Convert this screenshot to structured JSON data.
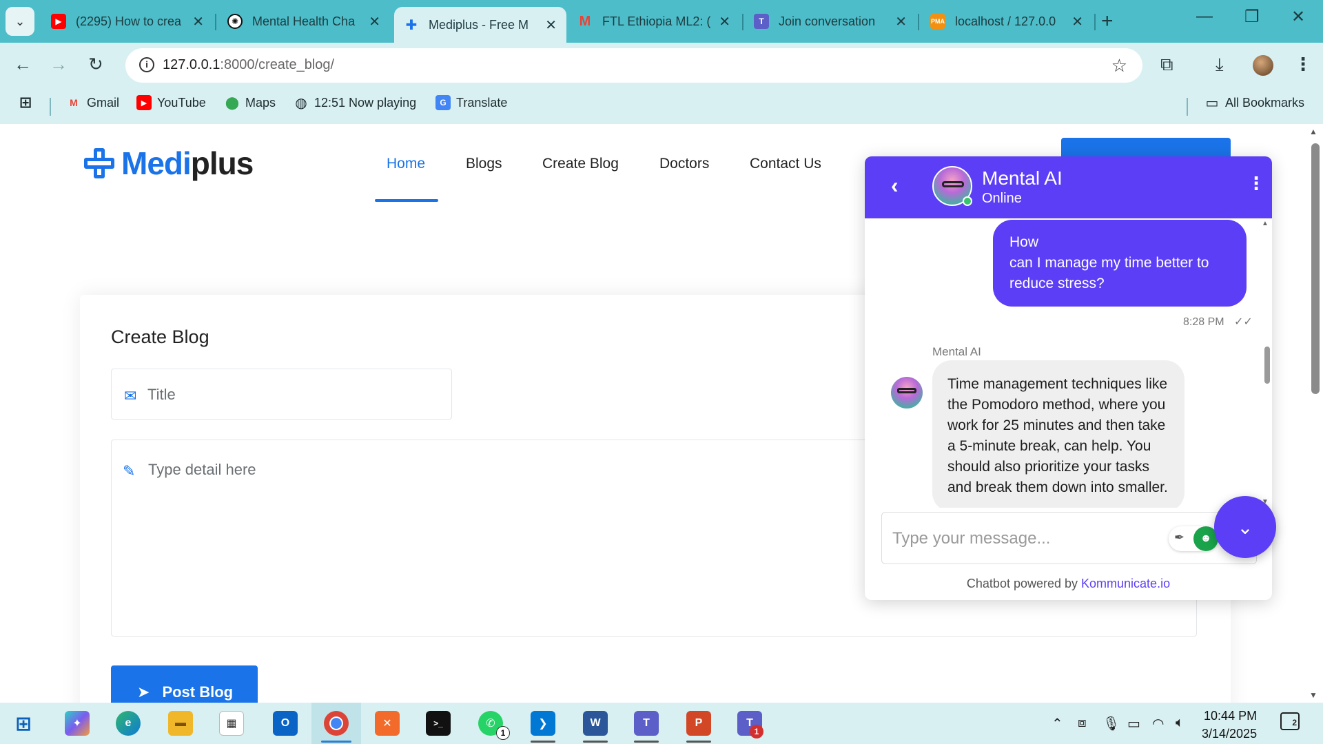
{
  "browser": {
    "tabs": [
      {
        "label": "(2295) How to crea",
        "favicon": "youtube-icon",
        "color": "#ff0000"
      },
      {
        "label": "Mental Health Cha",
        "favicon": "openai-icon",
        "color": "#111111"
      },
      {
        "label": "Mediplus - Free M",
        "favicon": "mediplus-icon",
        "color": "#1a73e8",
        "active": true
      },
      {
        "label": "FTL Ethiopia ML2: (",
        "favicon": "gmail-icon",
        "color": "#ea4335"
      },
      {
        "label": "Join conversation",
        "favicon": "teams-icon",
        "color": "#5b5fc7"
      },
      {
        "label": "localhost / 127.0.0",
        "favicon": "phpmyadmin-icon",
        "color": "#f29111"
      }
    ],
    "address": {
      "host": "127.0.0.1",
      "rest": ":8000/create_blog/"
    },
    "bookmarks": [
      {
        "label": "Gmail",
        "icon": "gmail-icon"
      },
      {
        "label": "YouTube",
        "icon": "youtube-icon"
      },
      {
        "label": "Maps",
        "icon": "maps-icon"
      },
      {
        "label": "12:51 Now playing",
        "icon": "globe-icon"
      },
      {
        "label": "Translate",
        "icon": "translate-icon"
      }
    ],
    "all_bookmarks": "All Bookmarks"
  },
  "site": {
    "logo": {
      "part1": "Medi",
      "part2": "plus"
    },
    "nav": [
      "Home",
      "Blogs",
      "Create Blog",
      "Doctors",
      "Contact Us"
    ],
    "brand_color": "#1a73e8"
  },
  "form": {
    "heading": "Create Blog",
    "title_placeholder": "Title",
    "detail_placeholder": "Type detail here",
    "submit_label": "Post Blog"
  },
  "chat": {
    "bot_name": "Mental AI",
    "status": "Online",
    "accent": "#5b3ef5",
    "user_message": {
      "line1": "How",
      "line2": "can I manage my time better to",
      "line3": "reduce stress?"
    },
    "user_time": "8:28 PM",
    "bot_label": "Mental AI",
    "bot_message": "Time management techniques like the Pomodoro method, where you work for 25 minutes and then take a 5-minute break, can help. You should also prioritize your tasks and break them down into smaller.",
    "input_placeholder": "Type your message...",
    "powered_prefix": "Chatbot powered by ",
    "powered_brand": "Kommunicate.io"
  },
  "taskbar": {
    "time": "10:44 PM",
    "date": "3/14/2025",
    "notifications": "2",
    "whatsapp_badge": "1",
    "teams_badge": "1"
  }
}
